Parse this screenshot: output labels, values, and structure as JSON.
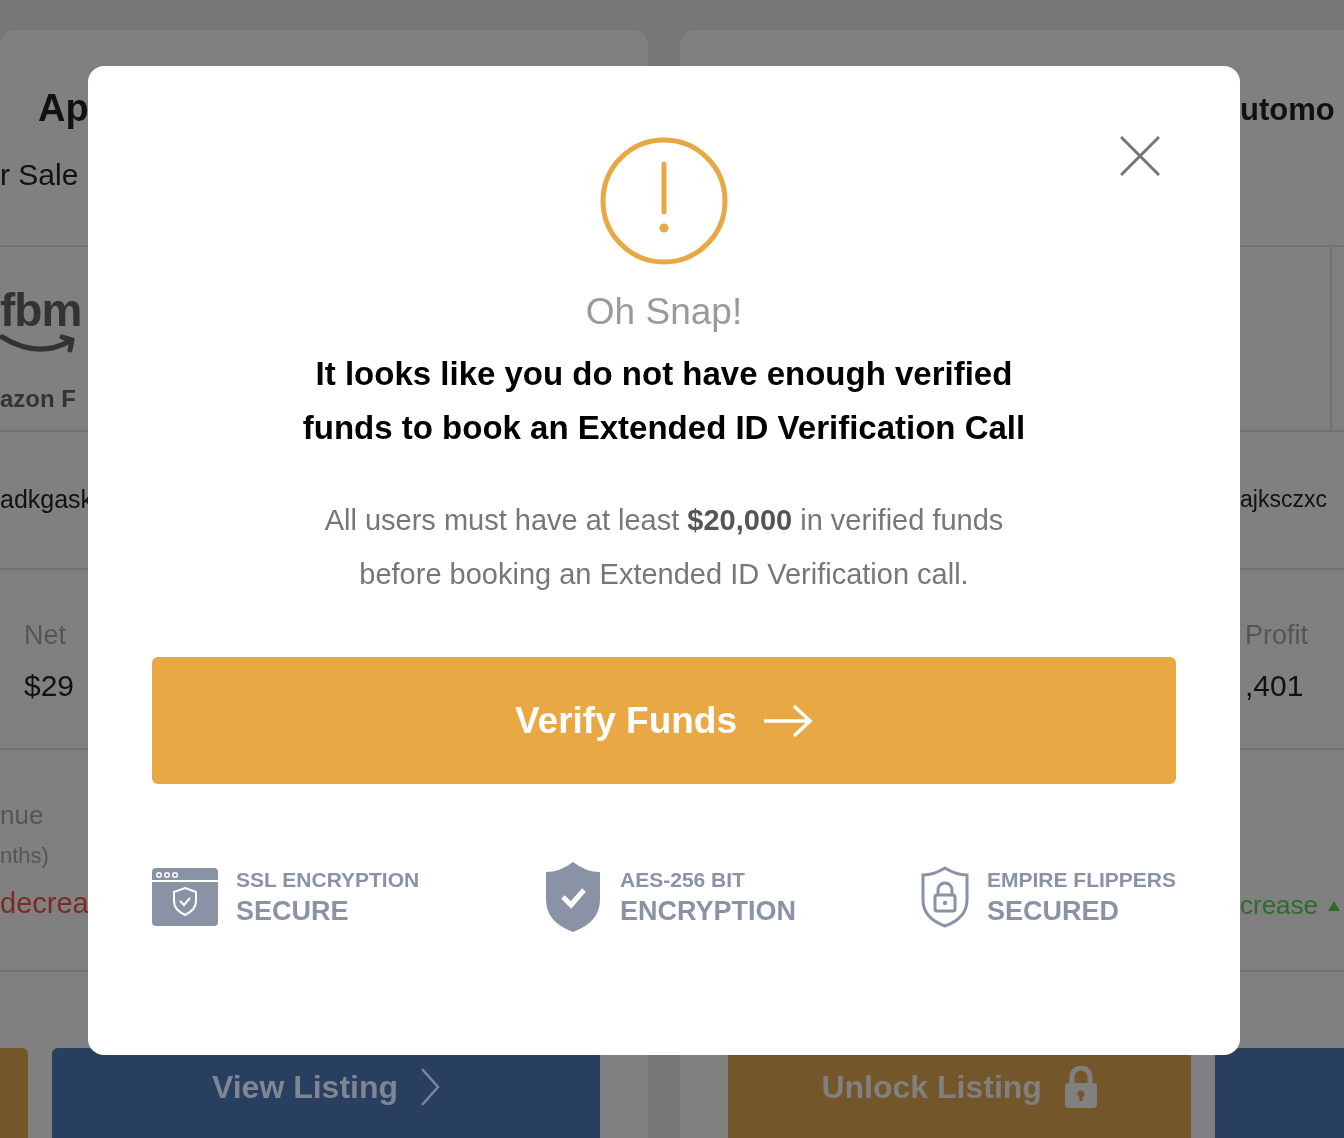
{
  "background": {
    "left_card": {
      "title": "Ap",
      "subtitle": "r Sale",
      "logo": "fbm",
      "logo_caption": "azon F",
      "name": "adkgask",
      "metric_label": "Net",
      "metric_value": "$29",
      "revenue_label": "nue",
      "revenue_period": "nths)",
      "trend": "decrea",
      "button": "View Listing"
    },
    "right_card": {
      "title": "utomo",
      "name": "ajksczxc",
      "metric_label": "Profit",
      "metric_value": ",401",
      "trend": "crease",
      "button": "Unlock Listing"
    }
  },
  "modal": {
    "title": "Oh Snap!",
    "heading": "It looks like you do not have enough verified funds to book an Extended ID Verification Call",
    "message": "All users must have at least **$20,000** in verified funds before booking an Extended ID Verification call.",
    "button": "Verify Funds",
    "badges": [
      {
        "kind": "browser",
        "line1": "SSL ENCRYPTION",
        "line2": "SECURE"
      },
      {
        "kind": "shield",
        "line1": "AES-256 BIT",
        "line2": "ENCRYPTION"
      },
      {
        "kind": "lock",
        "line1": "EMPIRE FLIPPERS",
        "line2": "SECURED"
      }
    ]
  }
}
